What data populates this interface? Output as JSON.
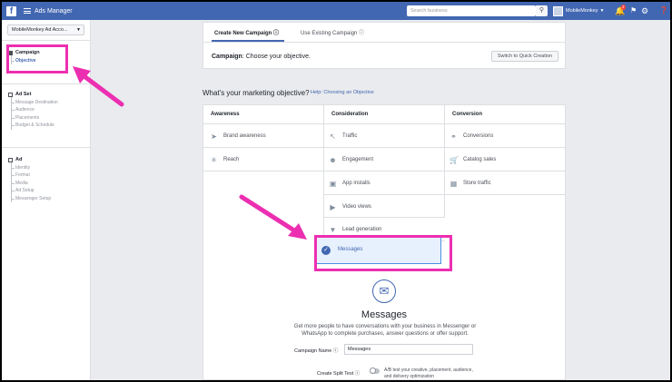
{
  "topbar": {
    "logo": "f",
    "app_title": "Ads Manager",
    "search_placeholder": "Search business",
    "search_icon": "search-icon",
    "user_name": "MobileMonkey",
    "notification_count": "2"
  },
  "sidebar": {
    "account": "MobileMonkey Ad Acco...",
    "campaign": {
      "title": "Campaign",
      "items": [
        "Objective"
      ]
    },
    "adset": {
      "title": "Ad Set",
      "items": [
        "Message Destination",
        "Audience",
        "Placements",
        "Budget & Schedule"
      ]
    },
    "ad": {
      "title": "Ad",
      "items": [
        "Identity",
        "Format",
        "Media",
        "Ad Setup",
        "Messenger Setup"
      ]
    }
  },
  "tabs": {
    "create_new": "Create New Campaign",
    "use_existing": "Use Existing Campaign"
  },
  "campaign_row": {
    "label": "Campaign",
    "text": ": Choose your objective.",
    "quick_button": "Switch to Quick Creation"
  },
  "objective": {
    "question": "What's your marketing objective?",
    "help": "Help: Choosing an Objective"
  },
  "columns": {
    "awareness": {
      "title": "Awareness",
      "items": [
        "Brand awareness",
        "Reach"
      ]
    },
    "consideration": {
      "title": "Consideration",
      "items": [
        "Traffic",
        "Engagement",
        "App installs",
        "Video views",
        "Lead generation",
        "Messages"
      ]
    },
    "conversion": {
      "title": "Conversion",
      "items": [
        "Conversions",
        "Catalog sales",
        "Store traffic"
      ]
    }
  },
  "selected": {
    "title": "Messages",
    "description": "Get more people to have conversations with your business in Messenger or WhatsApp to complete purchases, answer questions or offer support."
  },
  "form": {
    "campaign_name_label": "Campaign Name",
    "campaign_name_value": "Messages",
    "split_test_label": "Create Split Test",
    "split_test_desc": "A/B test your creative, placement, audience, and delivery optimization"
  },
  "colors": {
    "accent": "#4267b2",
    "annotation": "#ec2fb1"
  }
}
